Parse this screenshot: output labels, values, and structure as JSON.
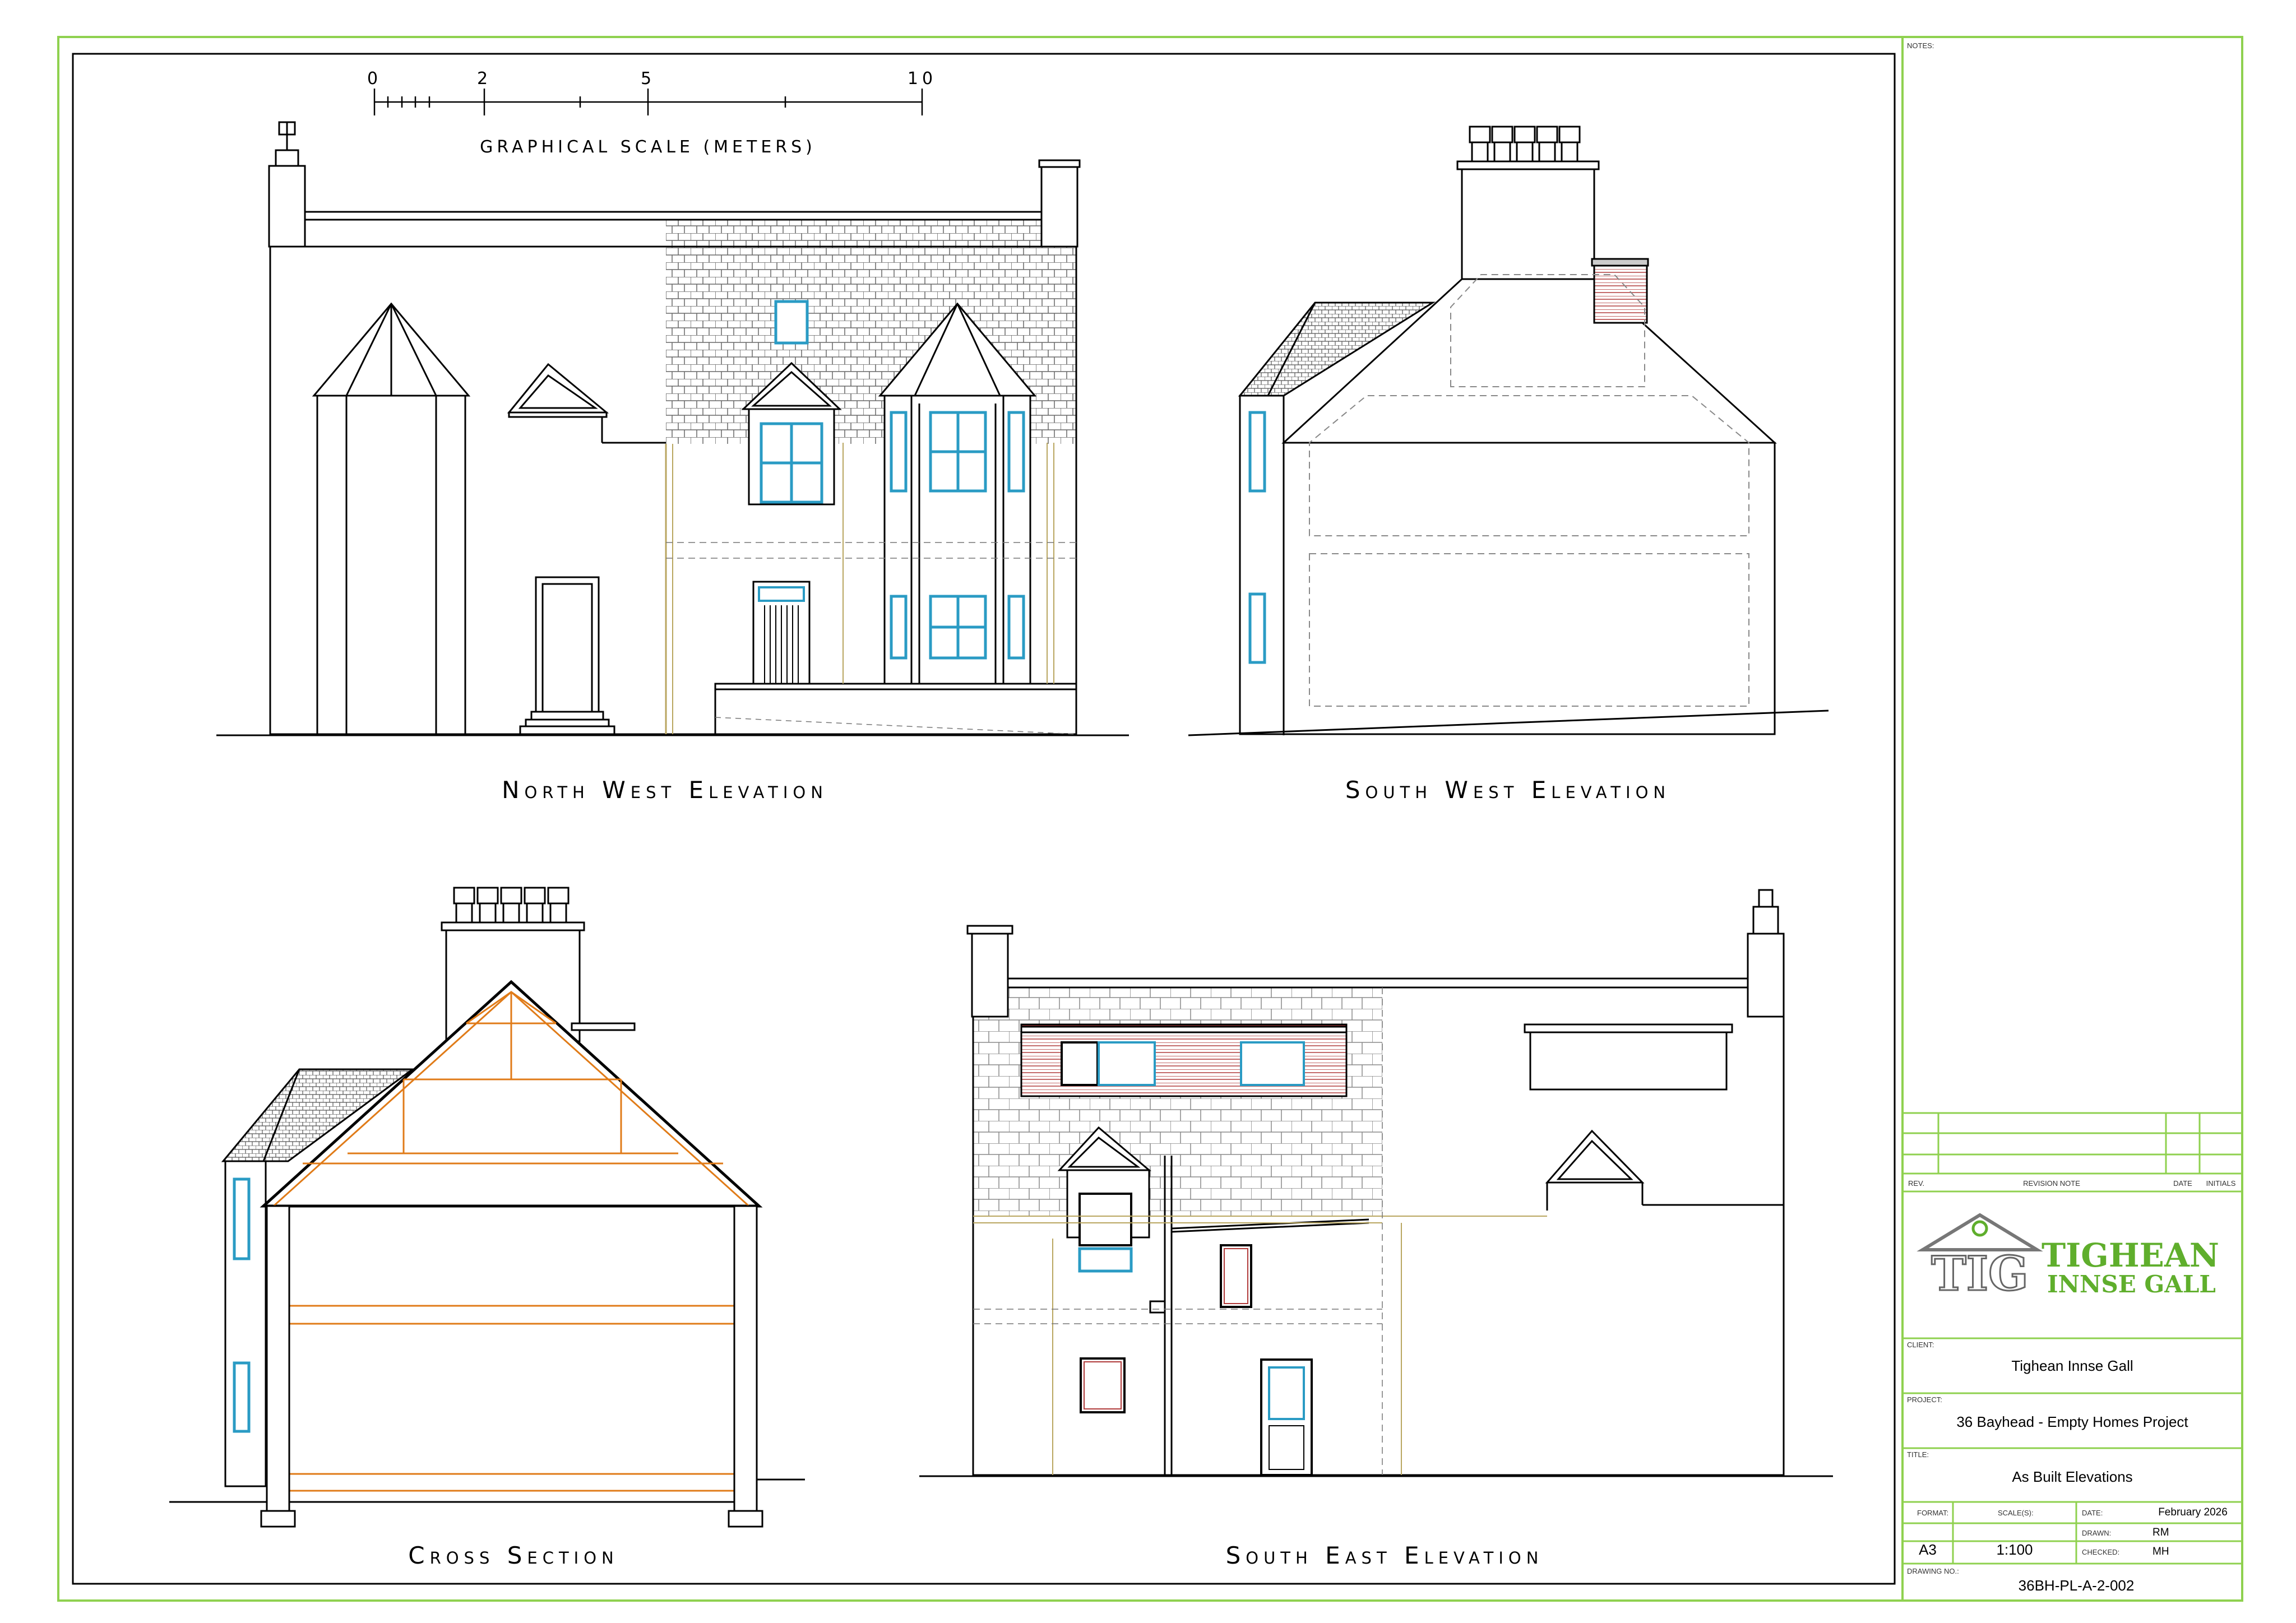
{
  "scale_bar": {
    "ticks": [
      "0",
      "2",
      "5",
      "10"
    ],
    "caption": "GRAPHICAL SCALE (METERS)"
  },
  "views": {
    "north_west": "North West Elevation",
    "south_west": "South West Elevation",
    "cross_section": "Cross Section",
    "south_east": "South East Elevation"
  },
  "title_block": {
    "notes_label": "NOTES:",
    "revision_headers": {
      "rev": "REV.",
      "note": "REVISION NOTE",
      "date": "DATE",
      "initials": "INITIALS"
    },
    "logo": {
      "line1": "TIGHEAN",
      "line2": "INNSE GALL",
      "monogram": "TIG"
    },
    "client_label": "CLIENT:",
    "client": "Tighean Innse Gall",
    "project_label": "PROJECT:",
    "project": "36 Bayhead - Empty Homes Project",
    "title_label": "TITLE:",
    "title": "As Built Elevations",
    "format_label": "FORMAT:",
    "format": "A3",
    "scale_label": "SCALE(S):",
    "scale": "1:100",
    "date_label": "DATE:",
    "date": "February 2026",
    "drawn_label": "DRAWN:",
    "drawn": "RM",
    "checked_label": "CHECKED:",
    "checked": "MH",
    "drawing_no_label": "DRAWING NO.:",
    "drawing_no": "36BH-PL-A-2-002"
  },
  "colors": {
    "border_green": "#8fd14f",
    "window_blue": "#2a9bc4",
    "timber_orange": "#e07b18",
    "logo_green": "#5fae2c",
    "brick_red": "#b03a3a"
  }
}
